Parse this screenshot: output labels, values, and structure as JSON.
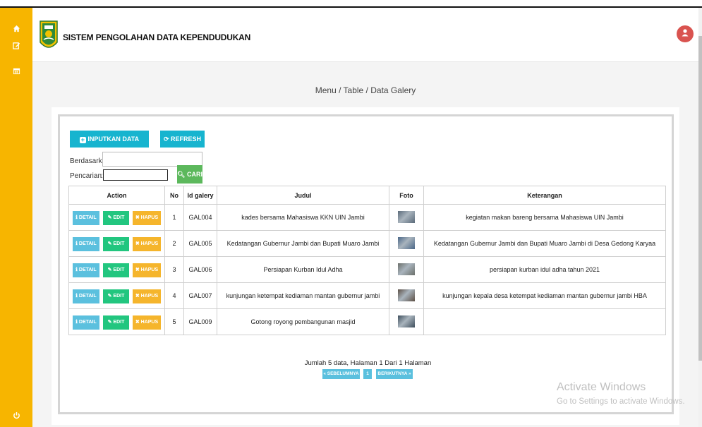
{
  "app": {
    "title": "SISTEM PENGOLAHAN DATA KEPENDUDUKAN",
    "sidebar_icons": [
      "home-icon",
      "edit-icon",
      "calendar-icon",
      "power-icon"
    ]
  },
  "breadcrumb": "Menu / Table / Data Galery",
  "toolbar": {
    "new_label": "INPUTKAN DATA BARU",
    "refresh_label": "REFRESH"
  },
  "filter": {
    "by_label": "Berdasarkan:",
    "search_label": "Pencarian",
    "search_colon": ":",
    "by_value": "",
    "search_value": "",
    "search_button": "CARI"
  },
  "table": {
    "headers": [
      "Action",
      "No",
      "Id galery",
      "Judul",
      "Foto",
      "Keterangan"
    ],
    "action_labels": {
      "detail": "DETAIL",
      "edit": "EDIT",
      "hapus": "HAPUS"
    },
    "rows": [
      {
        "no": "1",
        "id": "GAL004",
        "judul": "kades bersama Mahasiswa KKN UIN Jambi",
        "keterangan": "kegiatan makan bareng bersama Mahasiswa UIN Jambi",
        "photo_color": "#5a6a7a"
      },
      {
        "no": "2",
        "id": "GAL005",
        "judul": "Kedatangan Gubernur Jambi dan Bupati Muaro Jambi",
        "keterangan": "Kedatangan Gubernur Jambi dan Bupati Muaro Jambi di Desa Gedong Karyaa",
        "photo_color": "#4a6788"
      },
      {
        "no": "3",
        "id": "GAL006",
        "judul": "Persiapan Kurban Idul Adha",
        "keterangan": "persiapan kurban idul adha tahun 2021",
        "photo_color": "#6b6f6a"
      },
      {
        "no": "4",
        "id": "GAL007",
        "judul": "kunjungan ketempat kediaman mantan gubernur jambi",
        "keterangan": "kunjungan kepala desa ketempat kediaman mantan gubernur jambi HBA",
        "photo_color": "#5c4f45"
      },
      {
        "no": "5",
        "id": "GAL009",
        "judul": "Gotong royong pembangunan masjid",
        "keterangan": "",
        "photo_color": "#3e4e5c"
      }
    ]
  },
  "pagination": {
    "summary": "Jumlah 5 data, Halaman 1 Dari 1 Halaman",
    "prev": "« SEBELUMNYA",
    "current": "1",
    "next": "BERIKUTNYA »"
  },
  "watermark": {
    "line1": "Activate Windows",
    "line2": "Go to Settings to activate Windows."
  },
  "colors": {
    "sidebar": "#f7b500",
    "accent": "#17b4cf",
    "success": "#5cb85c",
    "edit": "#22c67f",
    "delete": "#f5b52c",
    "avatar": "#d9534f"
  }
}
